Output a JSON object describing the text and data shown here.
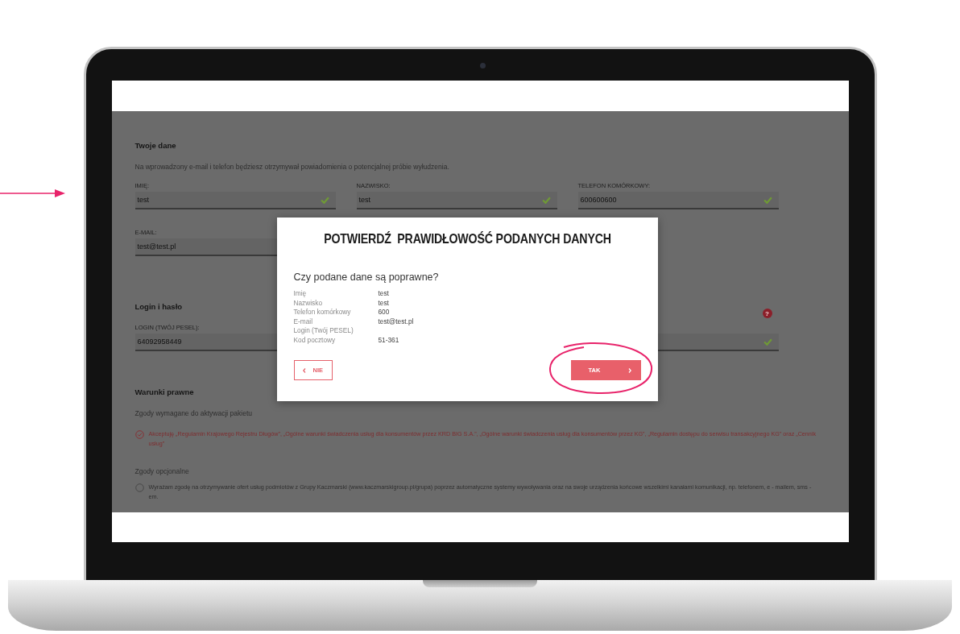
{
  "screen": {
    "personal": {
      "heading": "Twoje dane",
      "description": "Na wprowadzony e-mail i telefon będziesz otrzymywał powiadomienia o potencjalnej próbie wyłudzenia.",
      "fields": [
        {
          "label": "IMIĘ:",
          "value": "test",
          "valid": true
        },
        {
          "label": "NAZWISKO:",
          "value": "test",
          "valid": true
        },
        {
          "label": "TELEFON KOMÓRKOWY:",
          "value": "600600600",
          "valid": true
        },
        {
          "label": "E-MAIL:",
          "value": "test@test.pl"
        }
      ]
    },
    "login": {
      "heading": "Login i hasło",
      "fields": [
        {
          "label": "LOGIN (TWÓJ PESEL):",
          "value": "64092958449"
        },
        {
          "valid": true,
          "help": "?"
        }
      ]
    },
    "legal": {
      "heading": "Warunki prawne",
      "required_heading": "Zgody wymagane do aktywacji pakietu",
      "required_consent": {
        "text": "Akceptuję „Regulamin Krajowego Rejestru Długów”, „Ogólne warunki świadczenia usług dla konsumentów przez KRD BIG S.A.”, „Ogólne warunki świadczenia usług dla konsumentów przez KG”, „Regulamin dostępu do serwisu transakcyjnego KG” oraz „Cennik usług”",
        "checked": true
      },
      "optional_heading": "Zgody opcjonalne",
      "optional_consent": {
        "text": "Wyrażam zgodę na otrzymywanie ofert usług podmiotów z Grupy Kaczmarski (www.kaczmarskigroup.pl/grupa) poprzez automatyczne systemy wywoływania oraz na swoje urządzenia końcowe wszelkimi kanałami komunikacji, np. telefonem, e - mailem, sms - em.",
        "checked": false
      }
    },
    "modal": {
      "title": "POTWIERDŹ  PRAWIDŁOWOŚĆ PODANYCH DANYCH",
      "question": "Czy podane dane są poprawne?",
      "rows": [
        {
          "label": "Imię",
          "value": "test"
        },
        {
          "label": "Nazwisko",
          "value": "test"
        },
        {
          "label": "Telefon komórkowy",
          "value": "600"
        },
        {
          "label": "E-mail",
          "value": "test@test.pl"
        },
        {
          "label": "Login (Twój PESEL)"
        },
        {
          "label": "Kod pocztowy",
          "value": "51-361"
        }
      ],
      "buttons": [
        {
          "label": "NIE",
          "kind": "secondary"
        },
        {
          "label": "TAK",
          "kind": "primary"
        }
      ]
    }
  }
}
